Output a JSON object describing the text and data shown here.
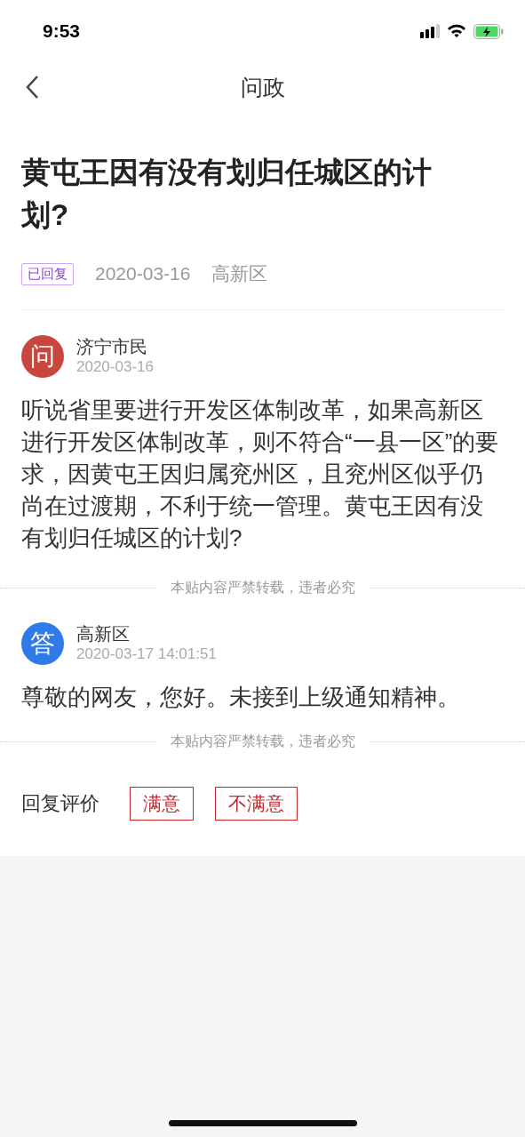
{
  "status_bar": {
    "time": "9:53"
  },
  "header": {
    "title": "问政"
  },
  "question": {
    "title": "黄屯王因有没有划归任城区的计划?",
    "status": "已回复",
    "date": "2020-03-16",
    "district": "高新区"
  },
  "posts": [
    {
      "kind": "question",
      "avatar": "问",
      "color": "#c8463c",
      "author": "济宁市民",
      "time": "2020-03-16",
      "body": "听说省里要进行开发区体制改革，如果高新区进行开发区体制改革，则不符合“一县一区”的要求，因黄屯王因归属兖州区，且兖州区似乎仍尚在过渡期，不利于统一管理。黄屯王因有没有划归任城区的计划?",
      "notice": "本贴内容严禁转载，违者必究"
    },
    {
      "kind": "answer",
      "avatar": "答",
      "color": "#2f7be8",
      "author": "高新区",
      "time": "2020-03-17 14:01:51",
      "body": "尊敬的网友，您好。未接到上级通知精神。",
      "notice": "本贴内容严禁转载，违者必究"
    }
  ],
  "rating": {
    "label": "回复评价",
    "options": [
      {
        "label": "满意",
        "selected": false
      },
      {
        "label": "不满意",
        "selected": false
      }
    ]
  }
}
